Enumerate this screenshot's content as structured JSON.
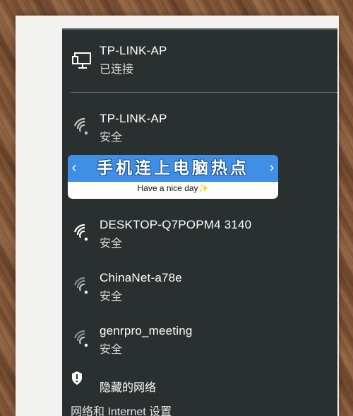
{
  "connected_network": {
    "name": "TP-LINK-AP",
    "status": "已连接",
    "icon": "ethernet-computer-icon"
  },
  "networks": [
    {
      "name": "TP-LINK-AP",
      "status": "安全",
      "icon": "wifi-secured-icon"
    },
    {
      "name": "DESKTOP-Q7POPM4 3140",
      "status": "安全",
      "icon": "wifi-secured-icon"
    },
    {
      "name": "ChinaNet-a78e",
      "status": "安全",
      "icon": "wifi-secured-icon"
    },
    {
      "name": "genrpro_meeting",
      "status": "安全",
      "icon": "wifi-secured-icon"
    }
  ],
  "hidden_network": {
    "label": "隐藏的网络",
    "icon": "shield-wifi-icon"
  },
  "settings_link": {
    "label": "网络和 Internet 设置"
  },
  "banner": {
    "title": "手机连上电脑热点",
    "subtitle": "Have a nice day",
    "sparkle": "✨",
    "left_arrow": "‹",
    "right_arrow": "›"
  },
  "colors": {
    "panel_bg": "#2a3030",
    "banner_blue": "#3f8fe6"
  }
}
